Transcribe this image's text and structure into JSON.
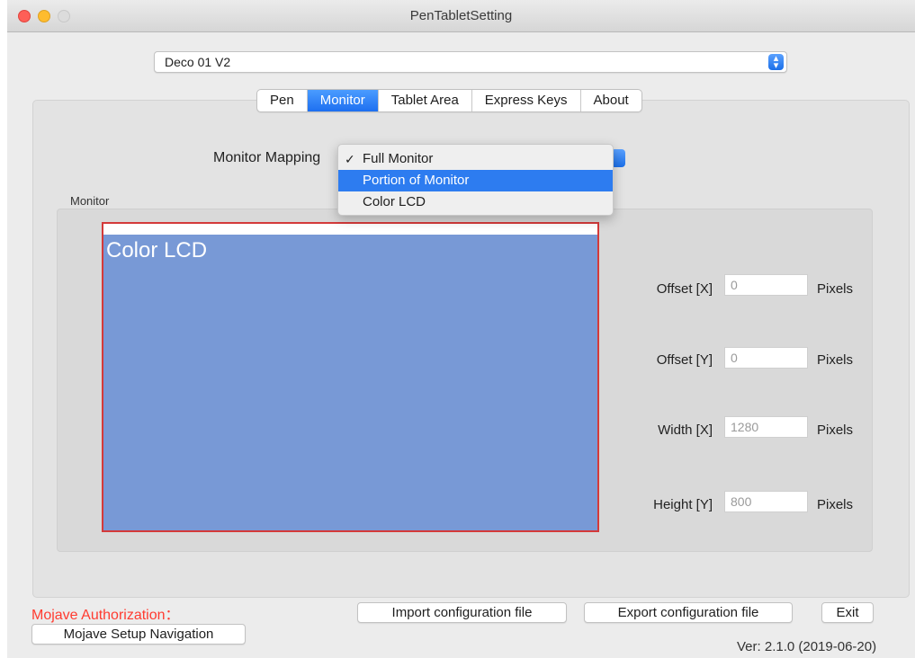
{
  "window": {
    "title": "PenTabletSetting"
  },
  "device": {
    "selected": "Deco 01 V2"
  },
  "tabs": [
    {
      "label": "Pen",
      "active": false
    },
    {
      "label": "Monitor",
      "active": true
    },
    {
      "label": "Tablet Area",
      "active": false
    },
    {
      "label": "Express Keys",
      "active": false
    },
    {
      "label": "About",
      "active": false
    }
  ],
  "monitor_mapping": {
    "label": "Monitor Mapping",
    "options": [
      {
        "label": "Full Monitor",
        "checked": true,
        "highlighted": false
      },
      {
        "label": "Portion of Monitor",
        "checked": false,
        "highlighted": true
      },
      {
        "label": "Color LCD",
        "checked": false,
        "highlighted": false
      }
    ],
    "check_glyph": "✓"
  },
  "monitor_group": {
    "label": "Monitor",
    "display_name": "Color LCD"
  },
  "fields": {
    "offset_x": {
      "label": "Offset [X]",
      "value": "0",
      "unit": "Pixels"
    },
    "offset_y": {
      "label": "Offset [Y]",
      "value": "0",
      "unit": "Pixels"
    },
    "width_x": {
      "label": "Width [X]",
      "value": "1280",
      "unit": "Pixels"
    },
    "height_y": {
      "label": "Height [Y]",
      "value": "800",
      "unit": "Pixels"
    }
  },
  "footer": {
    "auth_label": "Mojave Authorization：",
    "setup_nav": "Mojave Setup Navigation",
    "import_label": "Import configuration file",
    "export_label": "Export configuration file",
    "exit_label": "Exit",
    "version": "Ver: 2.1.0 (2019-06-20)"
  },
  "colors": {
    "accent": "#2d7cf0",
    "monitor_fill": "#7899d6",
    "monitor_border": "#d43a3a",
    "auth_text": "#ff3b30"
  }
}
